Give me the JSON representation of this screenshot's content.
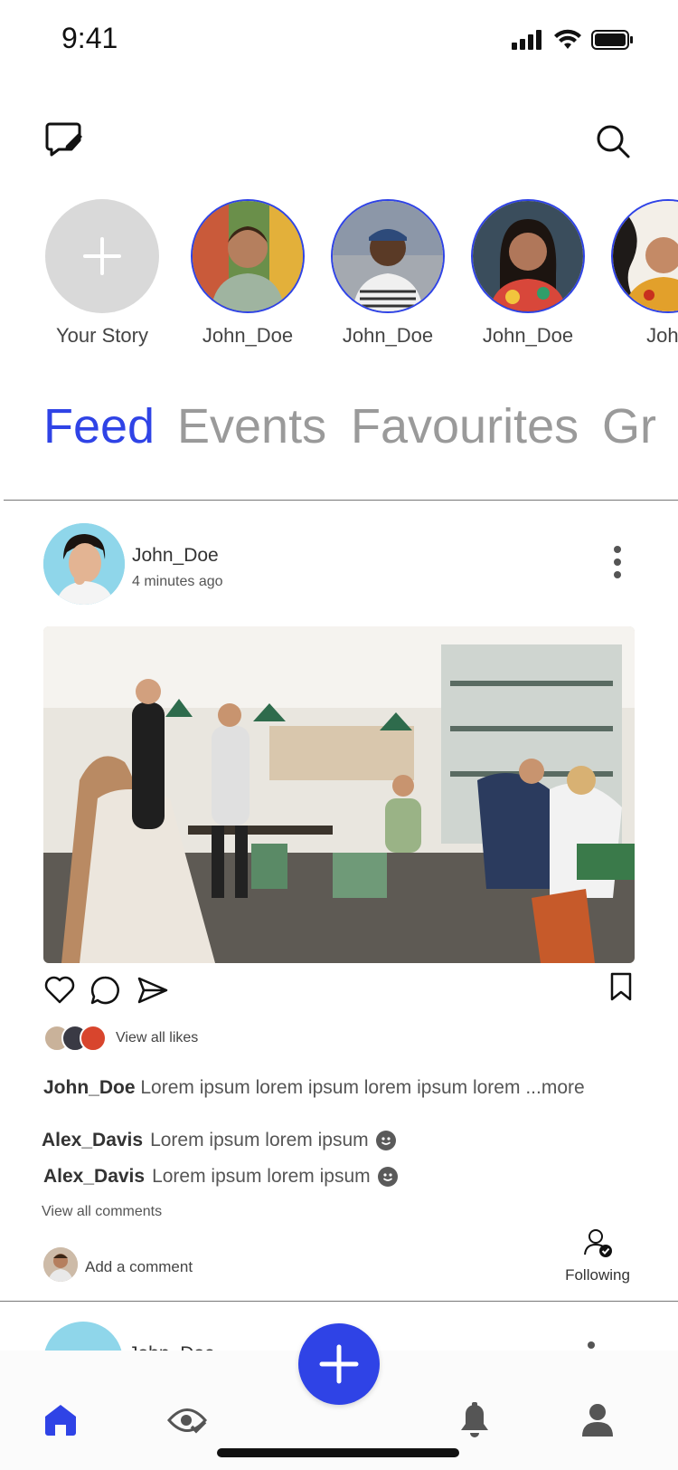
{
  "status_bar": {
    "time": "9:41"
  },
  "stories": [
    {
      "label": "Your Story",
      "type": "add"
    },
    {
      "label": "John_Doe",
      "type": "story"
    },
    {
      "label": "John_Doe",
      "type": "story"
    },
    {
      "label": "John_Doe",
      "type": "story"
    },
    {
      "label": "John",
      "type": "story"
    }
  ],
  "tabs": [
    "Feed",
    "Events",
    "Favourites",
    "Gr"
  ],
  "active_tab": "Feed",
  "post": {
    "username": "John_Doe",
    "time_ago": "4 minutes ago",
    "likes_text": "View all likes",
    "caption_user": "John_Doe",
    "caption_text": "Lorem ipsum lorem ipsum lorem ipsum lorem",
    "caption_more": "...more",
    "comments": [
      {
        "user": "Alex_Davis",
        "text": "Lorem ipsum lorem ipsum"
      },
      {
        "user": "Alex_Davis",
        "text": "Lorem ipsum lorem ipsum"
      }
    ],
    "view_comments": "View all comments",
    "add_comment_placeholder": "Add a comment",
    "following_label": "Following"
  },
  "next_post": {
    "username": "John_Doe"
  },
  "colors": {
    "accent": "#2f43e6",
    "story_add_bg": "#d9d9d9",
    "muted_tab": "#9a9a9a"
  },
  "icons": {
    "top_left": "chat-edit-icon",
    "top_right": "search-icon",
    "actions": [
      "heart-icon",
      "comment-icon",
      "send-icon",
      "bookmark-icon"
    ],
    "nav": [
      "home-icon",
      "eye-check-icon",
      "add-icon",
      "bell-icon",
      "profile-icon"
    ]
  }
}
